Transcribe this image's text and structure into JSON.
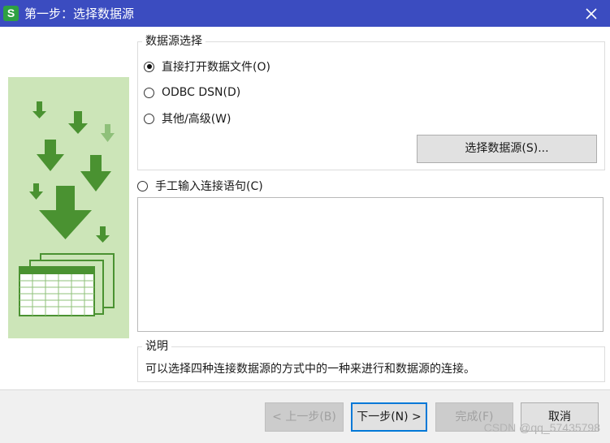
{
  "window": {
    "title": "第一步：选择数据源",
    "app_icon_letter": "S"
  },
  "datasource_group": {
    "label": "数据源选择",
    "options": [
      {
        "label": "直接打开数据文件(O)",
        "checked": true
      },
      {
        "label": "ODBC DSN(D)",
        "checked": false
      },
      {
        "label": "其他/高级(W)",
        "checked": false
      }
    ],
    "select_button": "选择数据源(S)..."
  },
  "manual": {
    "label": "手工输入连接语句(C)",
    "checked": false,
    "value": ""
  },
  "description": {
    "label": "说明",
    "text": "可以选择四种连接数据源的方式中的一种来进行和数据源的连接。"
  },
  "footer": {
    "prev": "< 上一步(B)",
    "next": "下一步(N) >",
    "finish": "完成(F)",
    "cancel": "取消"
  },
  "watermark": "CSDN @qq_57435798",
  "colors": {
    "titlebar": "#3b4cc0",
    "illustration_bg": "#cce5b8",
    "arrow_dark": "#4a9231",
    "arrow_light": "#8fc07a"
  }
}
